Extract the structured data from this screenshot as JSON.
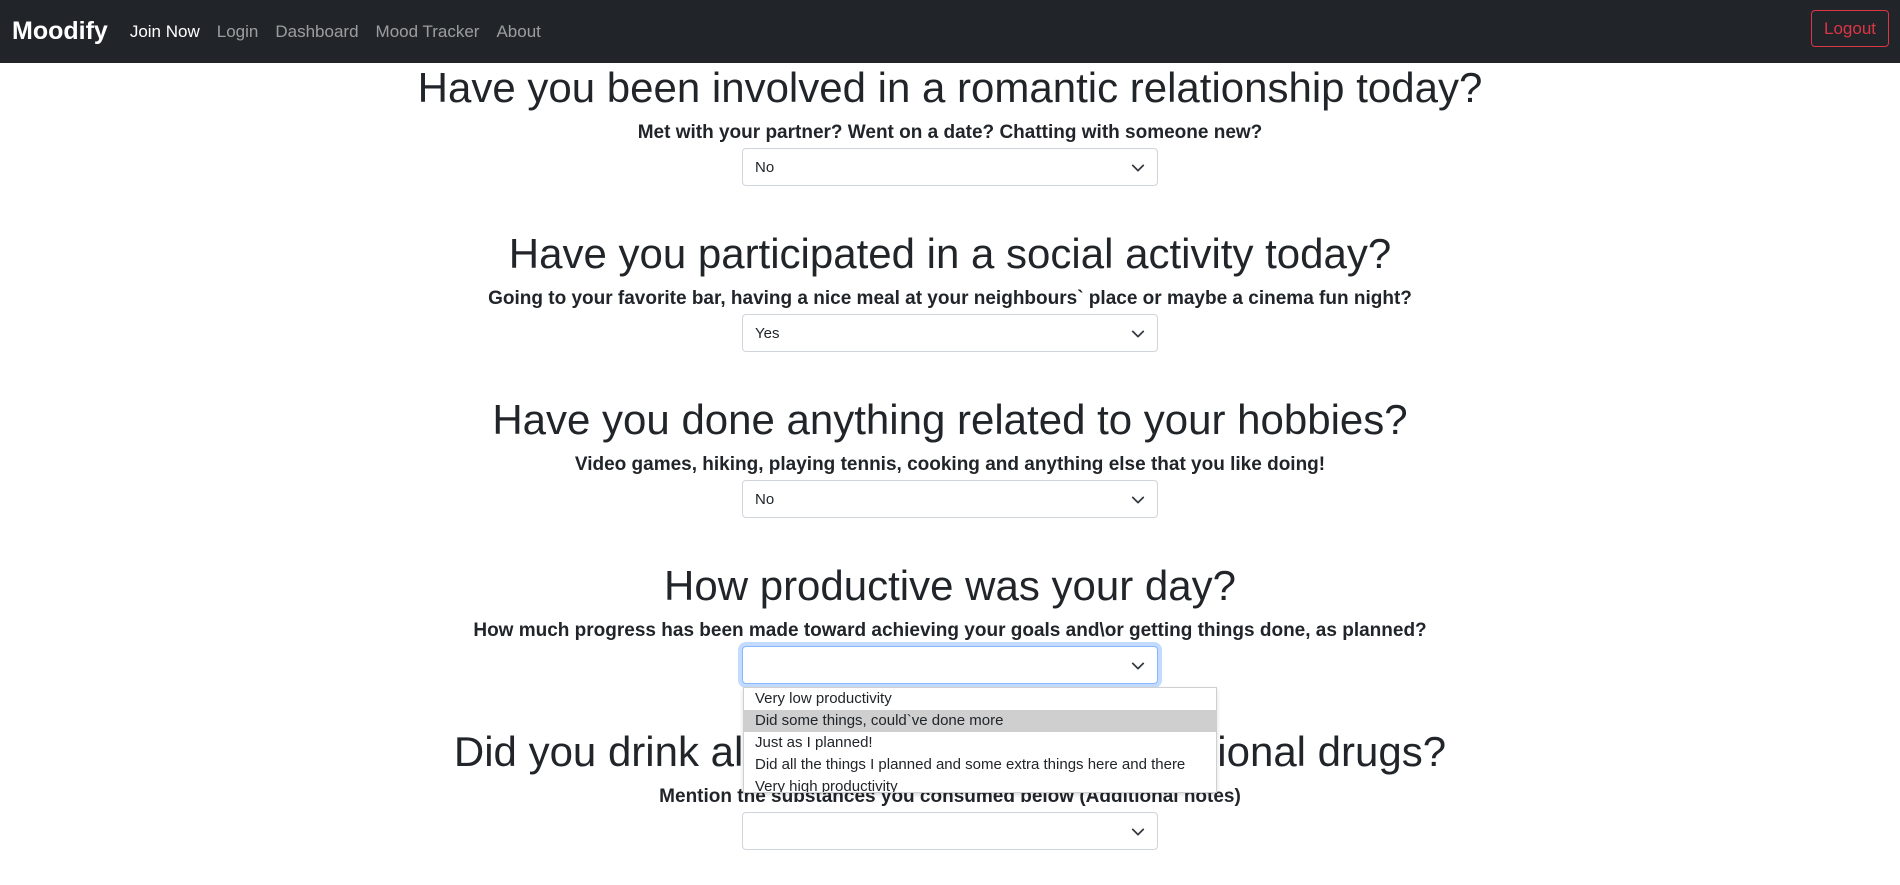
{
  "nav": {
    "brand": "Moodify",
    "links": [
      "Join Now",
      "Login",
      "Dashboard",
      "Mood Tracker",
      "About"
    ],
    "logout": "Logout"
  },
  "questions": [
    {
      "title": "Have you been involved in a romantic relationship today?",
      "subtitle": "Met with your partner? Went on a date? Chatting with someone new?",
      "selected": "No"
    },
    {
      "title": "Have you participated in a social activity today?",
      "subtitle": "Going to your favorite bar, having a nice meal at your neighbours` place or maybe a cinema fun night?",
      "selected": "Yes"
    },
    {
      "title": "Have you done anything related to your hobbies?",
      "subtitle": "Video games, hiking, playing tennis, cooking and anything else that you like doing!",
      "selected": "No"
    },
    {
      "title": "How productive was your day?",
      "subtitle": "How much progress has been made toward achieving your goals and\\or getting things done, as planned?",
      "selected": ""
    },
    {
      "title": "Did you drink alcohol or used any recreational drugs?",
      "subtitle": "Mention the substances you consumed below (Additional notes)",
      "selected": ""
    }
  ],
  "productivity_options": [
    "Very low productivity",
    "Did some things, could`ve done more",
    "Just as I planned!",
    "Did all the things I planned and some extra things here and there",
    "Very high productivity"
  ],
  "colors": {
    "navbar_bg": "#212529",
    "logout": "#dc3545",
    "focus_border": "#86b7fe",
    "option_hover": "#cfcfcf"
  }
}
